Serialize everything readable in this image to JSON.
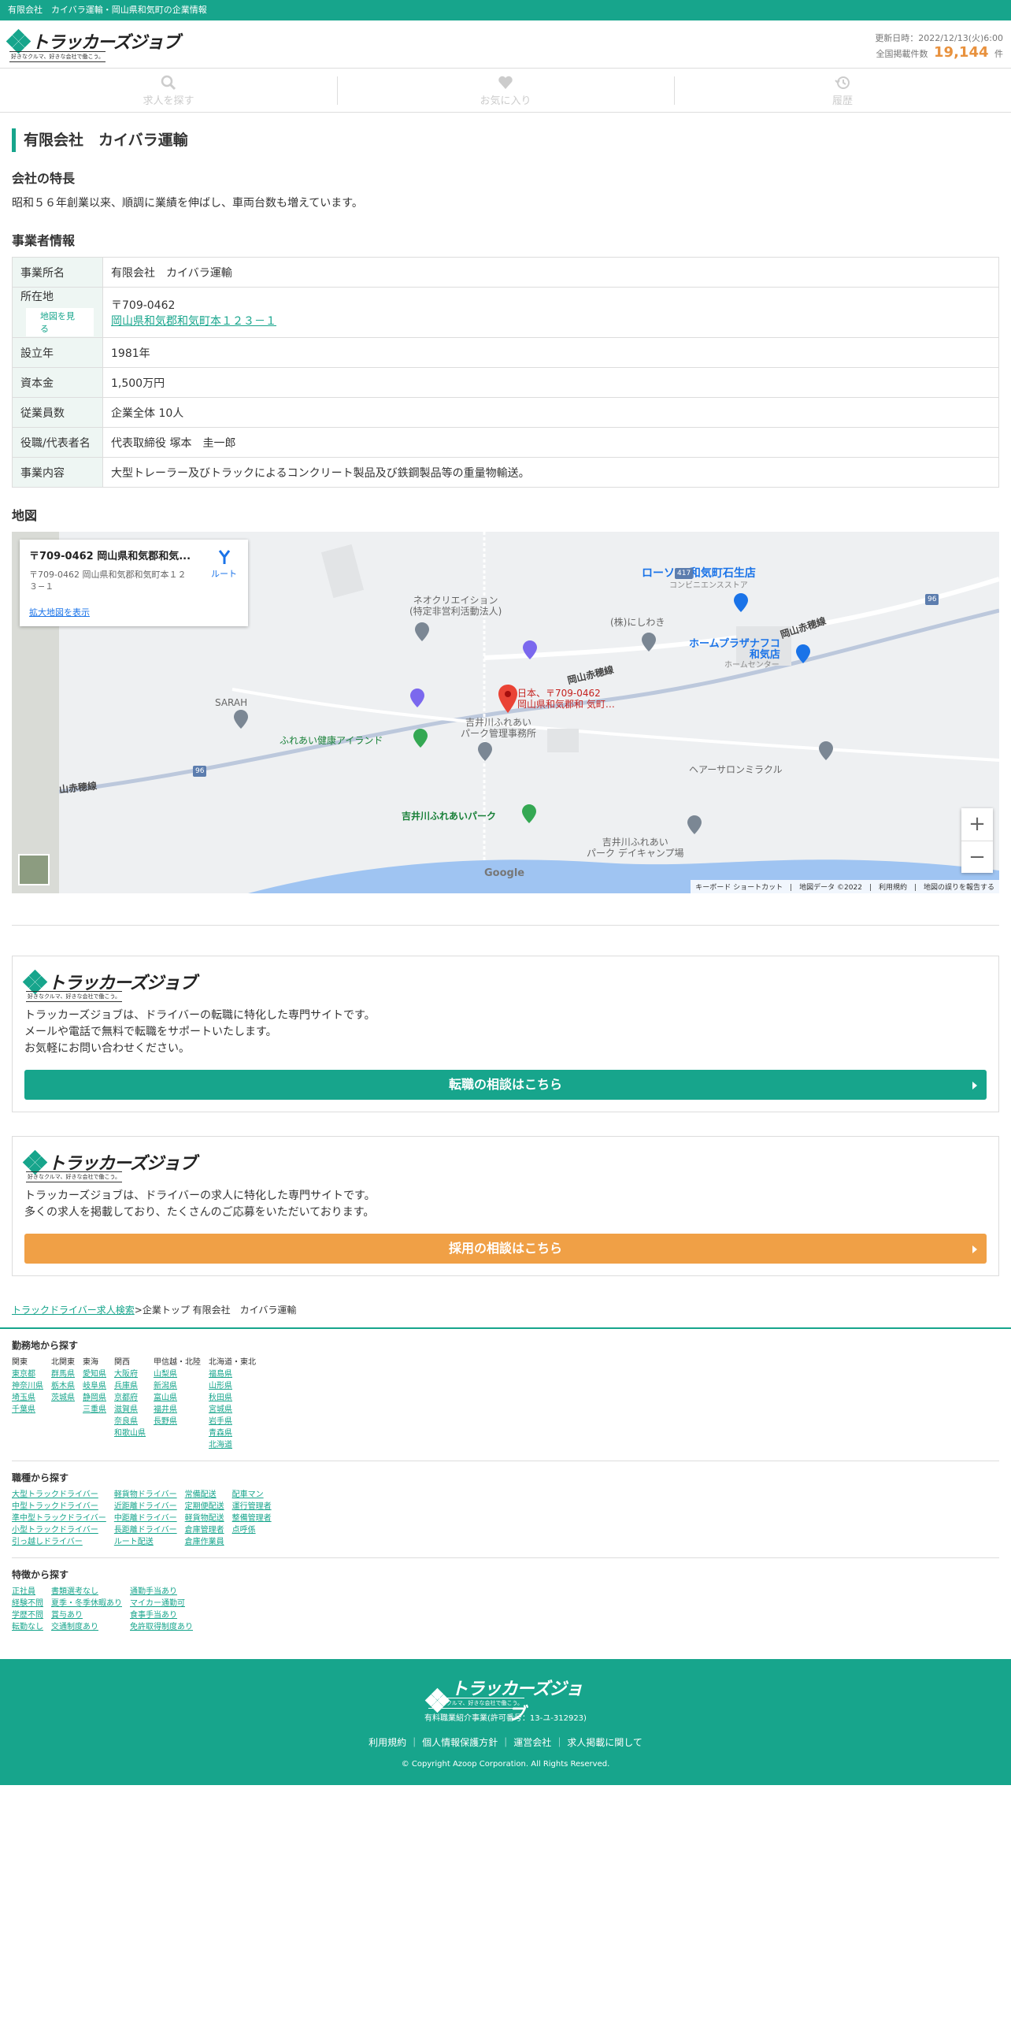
{
  "topbar": {
    "text": "有限会社　カイバラ運輸・岡山県和気町の企業情報"
  },
  "header": {
    "logo_text": "トラッカーズジョブ",
    "logo_tagline": "好きなクルマ、好きな会社で働こう。",
    "updated": "更新日時：2022/12/13(火)6:00",
    "count_label": "全国掲載件数",
    "count": "19,144",
    "count_unit": "件"
  },
  "nav": [
    {
      "label": "求人を探す",
      "icon": "search-icon"
    },
    {
      "label": "お気に入り",
      "icon": "heart-icon"
    },
    {
      "label": "履歴",
      "icon": "history-icon"
    }
  ],
  "company": {
    "name": "有限会社　カイバラ運輸",
    "feature_heading": "会社の特長",
    "feature_text": "昭和５６年創業以来、順調に業績を伸ばし、車両台数も増えています。",
    "info_heading": "事業者情報",
    "map_button": "地図を見る",
    "rows": [
      {
        "label": "事業所名",
        "value": "有限会社　カイバラ運輸"
      },
      {
        "label": "所在地",
        "value": "〒709-0462",
        "link": "岡山県和気郡和気町本１２３－１"
      },
      {
        "label": "設立年",
        "value": "1981年"
      },
      {
        "label": "資本金",
        "value": "1,500万円"
      },
      {
        "label": "従業員数",
        "value": "企業全体 10人"
      },
      {
        "label": "役職/代表者名",
        "value": "代表取締役 塚本　圭一郎"
      },
      {
        "label": "事業内容",
        "value": "大型トレーラー及びトラックによるコンクリート製品及び鉄鋼製品等の重量物輸送。"
      }
    ]
  },
  "map": {
    "heading": "地図",
    "card_title": "〒709-0462 岡山県和気郡和気...",
    "card_sub": "〒709-0462 岡山県和気郡和気町本１２３−１",
    "card_route": "ルート",
    "card_enlarge": "拡大地図を表示",
    "labels": {
      "neo": "ネオクリエイション\n(特定非営利活動法人)",
      "nishiwaki": "(株)にしわき",
      "lawson": "ローソン 和気町石生店",
      "lawson_sub": "コンビニエンスストア",
      "road1": "岡山赤穂線",
      "road2": "岡山赤穂線",
      "road3": "山赤穂線",
      "homeplaza": "ホームプラザナフコ\n和気店",
      "homeplaza_sub": "ホームセンター",
      "sarah": "SARAH",
      "pin": "日本、〒709-0462\n岡山県和気郡和 気町…",
      "fureai_island": "ふれあい健康アイランド",
      "fureai_mgmt": "吉井川ふれあい\nパーク管理事務所",
      "salon": "ヘアーサロンミラクル",
      "park": "吉井川ふれあいパーク",
      "camp": "吉井川ふれあい\nパーク デイキャンプ場",
      "route_417": "417",
      "route_96a": "96",
      "route_96b": "96",
      "google": "Google"
    },
    "zoom_in": "+",
    "zoom_out": "−",
    "footer": "キーボード ショートカット　|　地図データ ©2022　|　利用規約　|　地図の誤りを報告する"
  },
  "promo1": {
    "text": "トラッカーズジョブは、ドライバーの転職に特化した専門サイトです。\nメールや電話で無料で転職をサポートいたします。\nお気軽にお問い合わせください。",
    "button": "転職の相談はこちら",
    "color": "#17a58c"
  },
  "promo2": {
    "text": "トラッカーズジョブは、ドライバーの求人に特化した専門サイトです。\n多くの求人を掲載しており、たくさんのご応募をいただいております。",
    "button": "採用の相談はこちら",
    "color": "#f0a046"
  },
  "breadcrumb": {
    "link": "トラックドライバー求人検索",
    "sep": ">",
    "rest": "企業トップ 有限会社　カイバラ運輸"
  },
  "footer_links": {
    "area": {
      "title": "勤務地から探す",
      "cols": [
        {
          "head": "関東",
          "items": [
            "東京都",
            "神奈川県",
            "埼玉県",
            "千葉県"
          ]
        },
        {
          "head": "北関東",
          "items": [
            "群馬県",
            "栃木県",
            "茨城県"
          ]
        },
        {
          "head": "東海",
          "items": [
            "愛知県",
            "岐阜県",
            "静岡県",
            "三重県"
          ]
        },
        {
          "head": "関西",
          "items": [
            "大阪府",
            "兵庫県",
            "京都府",
            "滋賀県",
            "奈良県",
            "和歌山県"
          ]
        },
        {
          "head": "甲信越・北陸",
          "items": [
            "山梨県",
            "新潟県",
            "富山県",
            "福井県",
            "長野県"
          ]
        },
        {
          "head": "北海道・東北",
          "items": [
            "福島県",
            "山形県",
            "秋田県",
            "宮城県",
            "岩手県",
            "青森県",
            "北海道"
          ]
        }
      ]
    },
    "job": {
      "title": "職種から探す",
      "cols": [
        {
          "items": [
            "大型トラックドライバー",
            "中型トラックドライバー",
            "準中型トラックドライバー",
            "小型トラックドライバー",
            "引っ越しドライバー"
          ]
        },
        {
          "items": [
            "軽貨物ドライバー",
            "近距離ドライバー",
            "中距離ドライバー",
            "長距離ドライバー",
            "ルート配送"
          ]
        },
        {
          "items": [
            "常備配送",
            "定期便配送",
            "軽貨物配送",
            "倉庫管理者",
            "倉庫作業員"
          ]
        },
        {
          "items": [
            "配車マン",
            "運行管理者",
            "整備管理者",
            "点呼係"
          ]
        }
      ]
    },
    "feature": {
      "title": "特徴から探す",
      "cols": [
        {
          "items": [
            "正社員",
            "経験不問",
            "学歴不問",
            "転勤なし"
          ]
        },
        {
          "items": [
            "書類選考なし",
            "夏季・冬季休暇あり",
            "賞与あり",
            "交通制度あり"
          ]
        },
        {
          "items": [
            "通勤手当あり",
            "マイカー通勤可",
            "食事手当あり",
            "免許取得制度あり"
          ]
        }
      ]
    }
  },
  "footer": {
    "license": "有料職業紹介事業(許可番号：13-ユ-312923)",
    "links": [
      "利用規約",
      "個人情報保護方針",
      "運営会社",
      "求人掲載に関して"
    ],
    "copyright": "© Copyright Azoop Corporation. All Rights Reserved."
  }
}
